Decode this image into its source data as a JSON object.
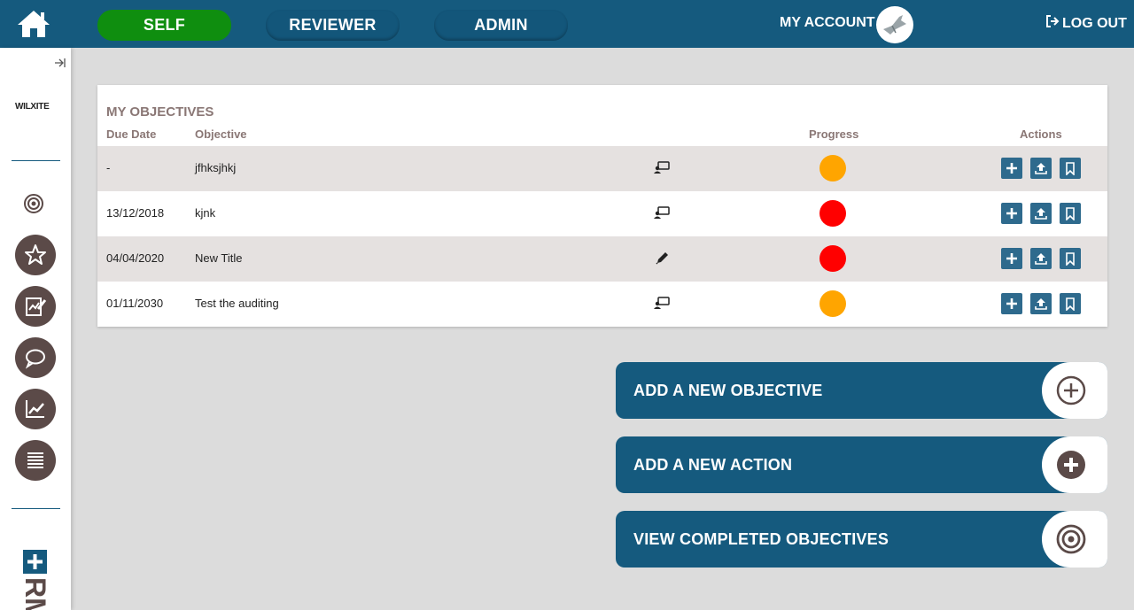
{
  "topbar": {
    "home_icon": "home-icon",
    "nav": [
      {
        "label": "SELF",
        "active": true
      },
      {
        "label": "REVIEWER",
        "active": false
      },
      {
        "label": "ADMIN",
        "active": false
      }
    ],
    "account_label": "MY ACCOUNT",
    "logout_label": "LOG OUT",
    "brand_color": "#155a7e",
    "active_color": "#0f8e0f"
  },
  "sidebar": {
    "logo_text": "WILXITE",
    "brand_text": "RM",
    "icons": [
      "target-icon",
      "star-icon",
      "edit-icon",
      "chat-icon",
      "chart-icon",
      "list-icon"
    ]
  },
  "objectives": {
    "title": "MY OBJECTIVES",
    "columns": {
      "due_date": "Due Date",
      "objective": "Objective",
      "progress": "Progress",
      "actions": "Actions"
    },
    "rows": [
      {
        "due_date": "-",
        "objective": "jfhksjhkj",
        "type_icon": "chat-icon",
        "progress_color": "#ffa500"
      },
      {
        "due_date": "13/12/2018",
        "objective": "kjnk",
        "type_icon": "chat-icon",
        "progress_color": "#ff0000"
      },
      {
        "due_date": "04/04/2020",
        "objective": "New Title",
        "type_icon": "pencil-icon",
        "progress_color": "#ff0000"
      },
      {
        "due_date": "01/11/2030",
        "objective": "Test the auditing",
        "type_icon": "chat-icon",
        "progress_color": "#ffa500"
      }
    ]
  },
  "buttons": {
    "add_objective": "ADD A NEW OBJECTIVE",
    "add_action": "ADD A NEW ACTION",
    "view_completed": "VIEW COMPLETED OBJECTIVES"
  }
}
